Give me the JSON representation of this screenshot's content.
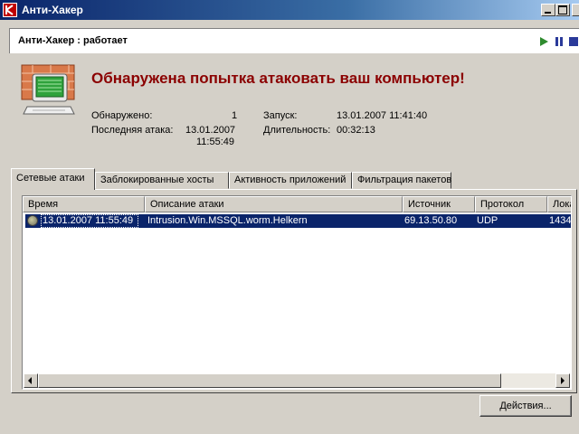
{
  "window": {
    "title": "Анти-Хакер"
  },
  "status": {
    "text": "Анти-Хакер : работает",
    "controls": [
      "play-icon",
      "pause-icon",
      "stop-icon"
    ]
  },
  "alert": {
    "title": "Обнаружена попытка атаковать ваш компьютер!",
    "detected_label": "Обнаружено:",
    "detected_value": "1",
    "last_attack_label": "Последняя атака:",
    "last_attack_date": "13.01.2007",
    "last_attack_time": "11:55:49",
    "launch_label": "Запуск:",
    "launch_value": "13.01.2007 11:41:40",
    "duration_label": "Длительность:",
    "duration_value": "00:32:13"
  },
  "tabs": [
    {
      "label": "Сетевые атаки",
      "active": true
    },
    {
      "label": "Заблокированные хосты",
      "active": false
    },
    {
      "label": "Активность приложений",
      "active": false
    },
    {
      "label": "Фильтрация пакетов",
      "active": false
    }
  ],
  "table": {
    "columns": [
      "Время",
      "Описание атаки",
      "Источник",
      "Протокол",
      "Лока"
    ],
    "rows": [
      {
        "time": "13.01.2007 11:55:49",
        "description": "Intrusion.Win.MSSQL.worm.Helkern",
        "source": "69.13.50.80",
        "protocol": "UDP",
        "local": "1434",
        "selected": true
      }
    ]
  },
  "actions_button": "Действия...",
  "colors": {
    "alert_red": "#8b0000",
    "selection": "#0a246a",
    "title_gradient_start": "#0a246a"
  }
}
